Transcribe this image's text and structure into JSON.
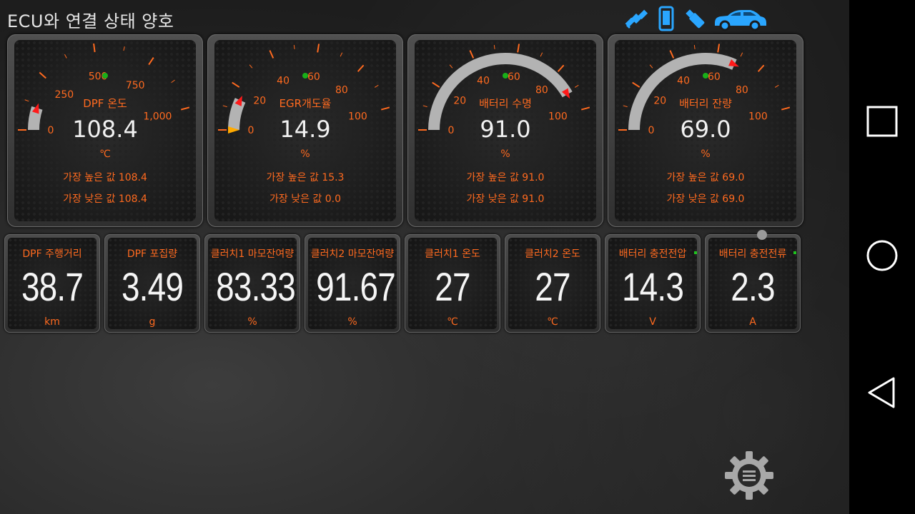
{
  "header": {
    "title": "ECU와 연결 상태 양호"
  },
  "status_icons": [
    "satellite-icon",
    "phone-icon",
    "usb-dongle-icon",
    "car-icon"
  ],
  "colors": {
    "accent": "#ff6a1f",
    "value": "#f2f2f2",
    "status_blue": "#2aa6ff",
    "needle_red": "#ff1a1a"
  },
  "gauges": [
    {
      "label": "DPF 온도",
      "value": "108.4",
      "unit": "℃",
      "max_text": "가장 높은 값 108.4",
      "min_text": "가장 낮은 값 108.4",
      "ticks": [
        "0",
        "250",
        "500",
        "750",
        "1,000"
      ],
      "fraction": 0.1084
    },
    {
      "label": "EGR개도율",
      "value": "14.9",
      "unit": "%",
      "max_text": "가장 높은 값 15.3",
      "min_text": "가장 낮은 값 0.0",
      "ticks": [
        "0",
        "20",
        "40",
        "60",
        "80",
        "100"
      ],
      "fraction": 0.149
    },
    {
      "label": "배터리 수명",
      "value": "91.0",
      "unit": "%",
      "max_text": "가장 높은 값 91.0",
      "min_text": "가장 낮은 값 91.0",
      "ticks": [
        "0",
        "20",
        "40",
        "60",
        "80",
        "100"
      ],
      "fraction": 0.91
    },
    {
      "label": "배터리 잔량",
      "value": "69.0",
      "unit": "%",
      "max_text": "가장 높은 값 69.0",
      "min_text": "가장 낮은 값 69.0",
      "ticks": [
        "0",
        "20",
        "40",
        "60",
        "80",
        "100"
      ],
      "fraction": 0.69
    }
  ],
  "tiles": [
    {
      "label": "DPF 주행거리",
      "value": "38.7",
      "unit": "km"
    },
    {
      "label": "DPF 포집량",
      "value": "3.49",
      "unit": "g"
    },
    {
      "label": "클러치1 마모잔여량",
      "value": "83.33",
      "unit": "%"
    },
    {
      "label": "클러치2 마모잔여량",
      "value": "91.67",
      "unit": "%"
    },
    {
      "label": "클러치1 온도",
      "value": "27",
      "unit": "℃"
    },
    {
      "label": "클러치2 온도",
      "value": "27",
      "unit": "℃"
    },
    {
      "label": "배터리 충전전압",
      "value": "14.3",
      "unit": "V"
    },
    {
      "label": "배터리 충전전류",
      "value": "2.3",
      "unit": "A"
    }
  ],
  "navbar": [
    "recents-square-icon",
    "home-circle-icon",
    "back-triangle-icon"
  ],
  "settings": {
    "icon": "settings-gear-menu-icon"
  }
}
